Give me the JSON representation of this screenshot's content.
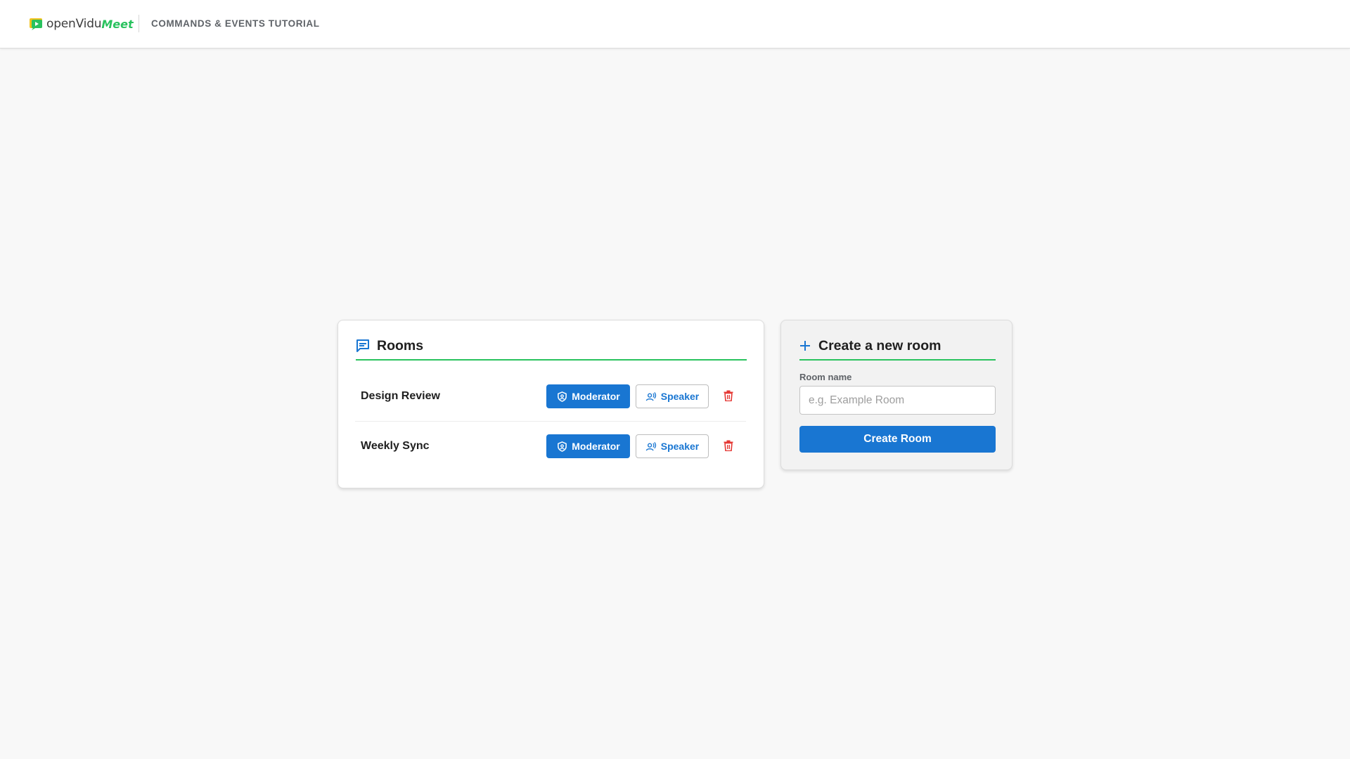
{
  "header": {
    "logo": {
      "text_main": "openVidu",
      "text_accent": "Meet",
      "icon": "openvidu-logo-icon"
    },
    "title": "COMMANDS & EVENTS TUTORIAL"
  },
  "rooms": {
    "heading": "Rooms",
    "heading_icon": "chat-bubble-icon",
    "items": [
      {
        "name": "Design Review",
        "moderator_label": "Moderator",
        "speaker_label": "Speaker"
      },
      {
        "name": "Weekly Sync",
        "moderator_label": "Moderator",
        "speaker_label": "Speaker"
      }
    ]
  },
  "create_room": {
    "heading": "Create a new room",
    "heading_icon": "plus-icon",
    "field_label": "Room name",
    "placeholder": "e.g. Example Room",
    "value": "",
    "button_label": "Create Room"
  },
  "colors": {
    "primary": "#1976d2",
    "accent_green": "#29c25e",
    "delete_red": "#e53935",
    "background": "#f8f8f8"
  }
}
